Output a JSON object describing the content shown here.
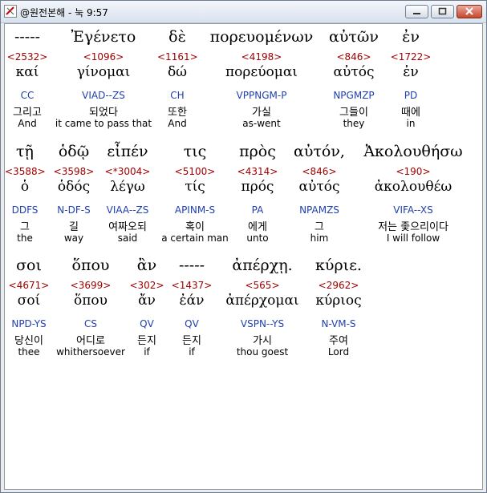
{
  "window": {
    "title": "@원전본해 - 눅 9:57"
  },
  "rows": [
    {
      "cols": [
        {
          "greek": "-----",
          "strong": "<2532>",
          "lemma": "καί",
          "parse": "CC",
          "korean": "그리고",
          "english": "And"
        },
        {
          "greek": "Ἐγένετο",
          "strong": "<1096>",
          "lemma": "γίνομαι",
          "parse": "VIAD--ZS",
          "korean": "되었다",
          "english": "it came to pass that"
        },
        {
          "greek": "δὲ",
          "strong": "<1161>",
          "lemma": "δώ",
          "parse": "CH",
          "korean": "또한",
          "english": "And"
        },
        {
          "greek": "πορευομένων",
          "strong": "<4198>",
          "lemma": "πορεύομαι",
          "parse": "VPPNGM-P",
          "korean": "가실",
          "english": "as-went"
        },
        {
          "greek": "αὐτῶν",
          "strong": "<846>",
          "lemma": "αὐτός",
          "parse": "NPGMZP",
          "korean": "그들이",
          "english": "they"
        },
        {
          "greek": "ἐν",
          "strong": "<1722>",
          "lemma": "ἐν",
          "parse": "PD",
          "korean": "때에",
          "english": "in"
        }
      ]
    },
    {
      "cols": [
        {
          "greek": "τῇ",
          "strong": "<3588>",
          "lemma": "ὁ",
          "parse": "DDFS",
          "korean": "그",
          "english": "the"
        },
        {
          "greek": "ὁδῷ",
          "strong": "<3598>",
          "lemma": "ὁδός",
          "parse": "N-DF-S",
          "korean": "길",
          "english": "way"
        },
        {
          "greek": "εἶπέν",
          "strong": "<*3004>",
          "lemma": "λέγω",
          "parse": "VIAA--ZS",
          "korean": "여짜오되",
          "english": "said"
        },
        {
          "greek": "τις",
          "strong": "<5100>",
          "lemma": "τίς",
          "parse": "APINM-S",
          "korean": "혹이",
          "english": "a certain man"
        },
        {
          "greek": "πρὸς",
          "strong": "<4314>",
          "lemma": "πρός",
          "parse": "PA",
          "korean": "에게",
          "english": "unto"
        },
        {
          "greek": "αὐτόν,",
          "strong": "<846>",
          "lemma": "αὐτός",
          "parse": "NPAMZS",
          "korean": "그",
          "english": "him"
        },
        {
          "greek": "Ἀκολουθήσω",
          "strong": "<190>",
          "lemma": "ἀκολουθέω",
          "parse": "VIFA--XS",
          "korean": "저는 좇으리이다",
          "english": "I will follow"
        }
      ]
    },
    {
      "cols": [
        {
          "greek": "σοι",
          "strong": "<4671>",
          "lemma": "σοί",
          "parse": "NPD-YS",
          "korean": "당신이",
          "english": "thee"
        },
        {
          "greek": "ὅπου",
          "strong": "<3699>",
          "lemma": "ὅπου",
          "parse": "CS",
          "korean": "어디로",
          "english": "whithersoever"
        },
        {
          "greek": "ἂν",
          "strong": "<302>",
          "lemma": "ἄν",
          "parse": "QV",
          "korean": "든지",
          "english": "if"
        },
        {
          "greek": "-----",
          "strong": "<1437>",
          "lemma": "ἐάν",
          "parse": "QV",
          "korean": "든지",
          "english": "if"
        },
        {
          "greek": "ἀπέρχῃ.",
          "strong": "<565>",
          "lemma": "ἀπέρχομαι",
          "parse": "VSPN--YS",
          "korean": "가시",
          "english": "thou goest"
        },
        {
          "greek": "κύριε.",
          "strong": "<2962>",
          "lemma": "κύριος",
          "parse": "N-VM-S",
          "korean": "주여",
          "english": "Lord"
        }
      ]
    }
  ]
}
